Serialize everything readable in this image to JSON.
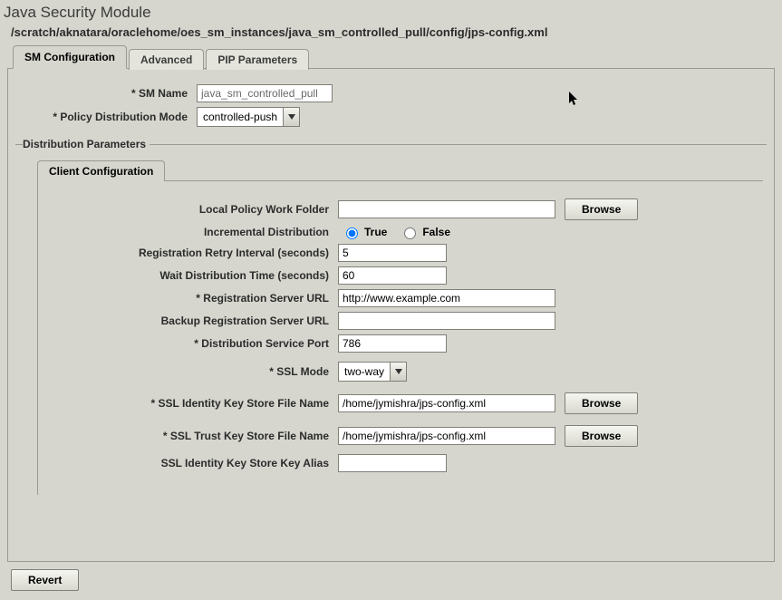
{
  "title": "Java Security Module",
  "config_path": "/scratch/aknatara/oraclehome/oes_sm_instances/java_sm_controlled_pull/config/jps-config.xml",
  "tabs": {
    "sm_config": "SM Configuration",
    "advanced": "Advanced",
    "pip": "PIP Parameters"
  },
  "form": {
    "sm_name_label": "* SM Name",
    "sm_name_value": "java_sm_controlled_pull",
    "pdm_label": "* Policy Distribution Mode",
    "pdm_value": "controlled-push"
  },
  "dist_params_legend": "Distribution Parameters",
  "client_config_tab": "Client Configuration",
  "client": {
    "local_policy_label": "Local Policy Work Folder",
    "local_policy_value": "",
    "browse": "Browse",
    "inc_dist_label": "Incremental Distribution",
    "inc_true": "True",
    "inc_false": "False",
    "retry_label": "Registration Retry Interval (seconds)",
    "retry_value": "5",
    "wait_label": "Wait Distribution Time (seconds)",
    "wait_value": "60",
    "reg_url_label": "* Registration Server URL",
    "reg_url_value": "http://www.example.com",
    "backup_url_label": "Backup Registration Server URL",
    "backup_url_value": "",
    "dist_port_label": "* Distribution Service Port",
    "dist_port_value": "786",
    "ssl_mode_label": "* SSL Mode",
    "ssl_mode_value": "two-way",
    "ssl_id_label": "* SSL Identity Key Store File Name",
    "ssl_id_value": "/home/jymishra/jps-config.xml",
    "ssl_trust_label": "* SSL Trust Key Store File Name",
    "ssl_trust_value": "/home/jymishra/jps-config.xml",
    "ssl_alias_label": "SSL Identity Key Store Key Alias",
    "ssl_alias_value": ""
  },
  "revert": "Revert"
}
